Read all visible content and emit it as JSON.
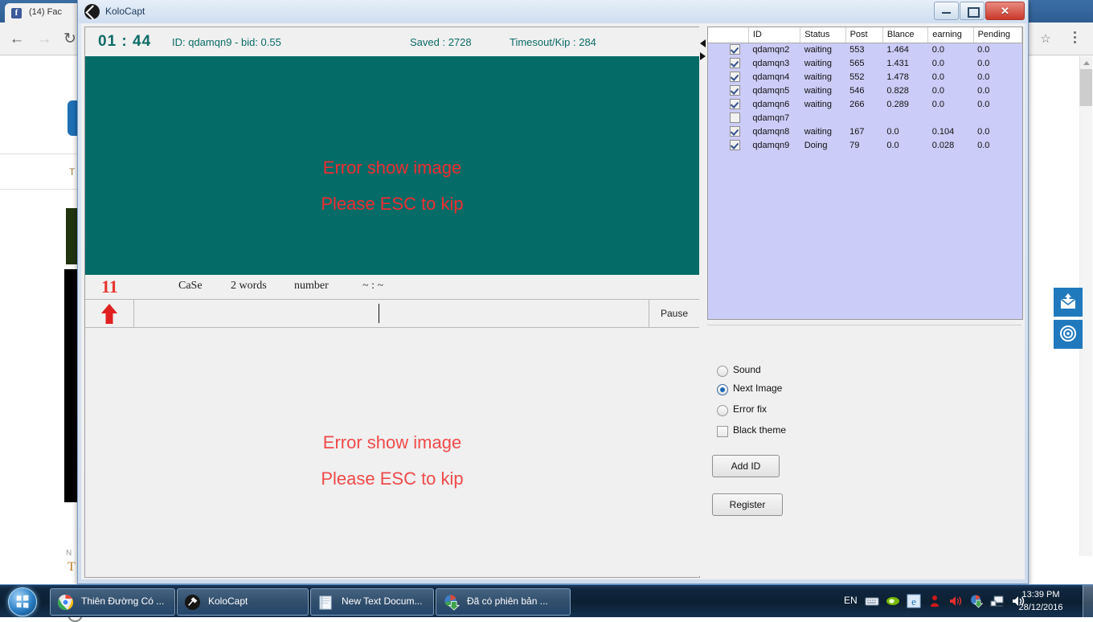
{
  "browser": {
    "tab_title": "(14) Fac",
    "nav": {
      "back": "←",
      "forward": "→",
      "reload": "↻"
    },
    "icons": {
      "star": "star-icon",
      "menu": "three-dot-menu-icon"
    },
    "page_fragments": {
      "t1": "T",
      "n": "N",
      "t2": "T"
    }
  },
  "side_widgets": [
    {
      "name": "mail-widget",
      "icon": "envelope-up-icon"
    },
    {
      "name": "target-widget",
      "icon": "target-icon"
    }
  ],
  "app": {
    "title": "KoloCapt",
    "window_buttons": {
      "minimize": "–",
      "maximize": "□",
      "close": "✕"
    },
    "status": {
      "timer": "01 : 44",
      "id_bid": "ID: qdamqn9 - bid: 0.55",
      "saved": "Saved : 2728",
      "timeout": "Timesout/Kip : 284"
    },
    "captcha": {
      "error_line1": "Error show image",
      "error_line2": "Please ESC to kip",
      "background_color": "#046b67",
      "error_color": "#ee2d32"
    },
    "hints": {
      "count": "11",
      "items": [
        "CaSe",
        "2 words",
        "number",
        "~ : ~"
      ]
    },
    "input": {
      "placeholder": "",
      "value": "",
      "pause_label": "Pause",
      "arrow_icon": "up-arrow-icon"
    },
    "bottom_panel": {
      "error_line1": "Error show image",
      "error_line2": "Please ESC to kip",
      "error_color": "#f04a4a"
    },
    "grid": {
      "columns": [
        "",
        "ID",
        "Status",
        "Post",
        "Blance",
        "earning",
        "Pending"
      ],
      "rows": [
        {
          "checked": true,
          "id": "qdamqn2",
          "status": "waiting",
          "post": "553",
          "blance": "1.464",
          "earning": "0.0",
          "pending": "0.0"
        },
        {
          "checked": true,
          "id": "qdamqn3",
          "status": "waiting",
          "post": "565",
          "blance": "1.431",
          "earning": "0.0",
          "pending": "0.0"
        },
        {
          "checked": true,
          "id": "qdamqn4",
          "status": "waiting",
          "post": "552",
          "blance": "1.478",
          "earning": "0.0",
          "pending": "0.0"
        },
        {
          "checked": true,
          "id": "qdamqn5",
          "status": "waiting",
          "post": "546",
          "blance": "0.828",
          "earning": "0.0",
          "pending": "0.0"
        },
        {
          "checked": true,
          "id": "qdamqn6",
          "status": "waiting",
          "post": "266",
          "blance": "0.289",
          "earning": "0.0",
          "pending": "0.0"
        },
        {
          "checked": false,
          "id": "qdamqn7",
          "status": "",
          "post": "",
          "blance": "",
          "earning": "",
          "pending": ""
        },
        {
          "checked": true,
          "id": "qdamqn8",
          "status": "waiting",
          "post": "167",
          "blance": "0.0",
          "earning": "0.104",
          "pending": "0.0"
        },
        {
          "checked": true,
          "id": "qdamqn9",
          "status": "Doing",
          "post": "79",
          "blance": "0.0",
          "earning": "0.028",
          "pending": "0.0"
        }
      ],
      "row_background": "#ccccf8"
    },
    "options": {
      "sound": "Sound",
      "next_image": "Next Image",
      "error_fix": "Error fix",
      "black_theme": "Black theme",
      "selected_radio": "Next Image",
      "black_theme_checked": false
    },
    "buttons": {
      "add_id": "Add ID",
      "register": "Register"
    }
  },
  "taskbar": {
    "start_label": "Start",
    "items": [
      {
        "label": "Thiên Đường Có ...",
        "icon": "chrome-icon"
      },
      {
        "label": "KoloCapt",
        "icon": "kolocapt-icon"
      },
      {
        "label": "New Text Docum...",
        "icon": "notepad-icon"
      },
      {
        "label": "Đã có phiên bản ...",
        "icon": "idm-icon"
      }
    ],
    "tray": {
      "language": "EN",
      "icons": [
        "keyboard-icon",
        "nvidia-icon",
        "ie-icon",
        "antivirus-icon",
        "volume-icon",
        "idm-tray-icon",
        "network-icon",
        "speaker-icon"
      ],
      "time": "13:39 PM",
      "date": "28/12/2016"
    }
  }
}
